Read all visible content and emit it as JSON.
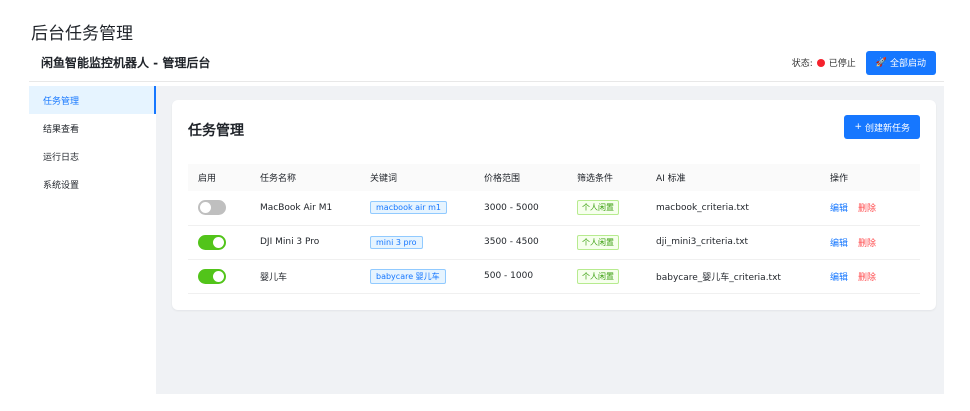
{
  "page_caption": "后台任务管理",
  "header": {
    "title": "闲鱼智能监控机器人 - 管理后台",
    "status_label": "状态:",
    "status_text": "已停止",
    "status_color": "#f5222d",
    "start_all_icon": "rocket-icon",
    "start_all_label": "全部启动"
  },
  "sidebar": {
    "items": [
      {
        "label": "任务管理",
        "active": true
      },
      {
        "label": "结果查看",
        "active": false
      },
      {
        "label": "运行日志",
        "active": false
      },
      {
        "label": "系统设置",
        "active": false
      }
    ]
  },
  "main": {
    "title": "任务管理",
    "create_button": {
      "icon": "plus-icon",
      "label": "创建新任务"
    },
    "table": {
      "columns": [
        "启用",
        "任务名称",
        "关键词",
        "价格范围",
        "筛选条件",
        "AI 标准",
        "操作"
      ],
      "rows": [
        {
          "enabled": false,
          "name": "MacBook Air M1",
          "keyword": "macbook air m1",
          "price": "3000 - 5000",
          "filter": "个人闲置",
          "criteria": "macbook_criteria.txt",
          "edit": "编辑",
          "delete": "删除"
        },
        {
          "enabled": true,
          "name": "DJI Mini 3 Pro",
          "keyword": "mini 3 pro",
          "price": "3500 - 4500",
          "filter": "个人闲置",
          "criteria": "dji_mini3_criteria.txt",
          "edit": "编辑",
          "delete": "删除"
        },
        {
          "enabled": true,
          "name": "婴儿车",
          "keyword": "babycare 婴儿车",
          "price": "500 - 1000",
          "filter": "个人闲置",
          "criteria": "babycare_婴儿车_criteria.txt",
          "edit": "编辑",
          "delete": "删除"
        }
      ]
    }
  },
  "colors": {
    "primary": "#1677ff",
    "switch_on": "#52c41a",
    "switch_off": "#bfbfbf",
    "danger": "#ff4d4f"
  }
}
